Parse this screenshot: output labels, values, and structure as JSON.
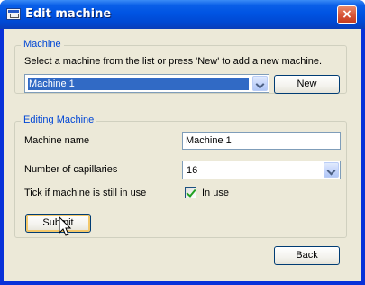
{
  "window": {
    "title": "Edit machine",
    "close_glyph": "×"
  },
  "machine_group": {
    "legend": "Machine",
    "instruction": "Select a machine from the list or press 'New' to add a new machine.",
    "machine_select_value": "Machine 1",
    "new_label": "New"
  },
  "editing_group": {
    "legend": "Editing Machine",
    "name_label": "Machine name",
    "name_value": "Machine 1",
    "capillaries_label": "Number of capillaries",
    "capillaries_value": "16",
    "in_use_label": "Tick if machine is still in use",
    "in_use_checkbox_label": "In use",
    "in_use_checked": true,
    "submit_label": "Submit"
  },
  "footer": {
    "back_label": "Back"
  },
  "colors": {
    "titlebar": "#0054e3",
    "legend": "#0046d5",
    "selection": "#316ac5",
    "dialog_bg": "#ece9d8"
  },
  "icons": [
    "window-icon",
    "close-icon",
    "dropdown-arrow-icon",
    "checkmark-icon",
    "mouse-cursor-icon"
  ]
}
